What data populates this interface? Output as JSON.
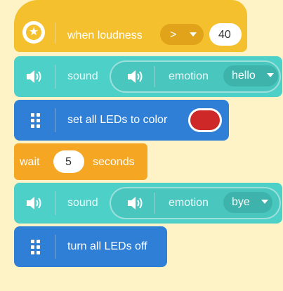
{
  "hat": {
    "label": "when loudness",
    "operator": ">",
    "value": "40"
  },
  "sound1": {
    "label": "sound",
    "emotion_label": "emotion",
    "emotion_value": "hello"
  },
  "leds": {
    "label": "set all LEDs to color",
    "color": "#cf2828"
  },
  "wait": {
    "label_before": "wait",
    "value": "5",
    "label_after": "seconds"
  },
  "sound2": {
    "label": "sound",
    "emotion_label": "emotion",
    "emotion_value": "bye"
  },
  "leds_off": {
    "label": "turn all LEDs off"
  },
  "colors": {
    "hat": "#f5c02e",
    "sound": "#4dd0c8",
    "leds": "#2f7fd6",
    "wait": "#f5a623",
    "background": "#fdf3c6"
  },
  "icons": {
    "hat": "star-icon",
    "sound": "speaker-icon",
    "leds": "grid-icon"
  }
}
